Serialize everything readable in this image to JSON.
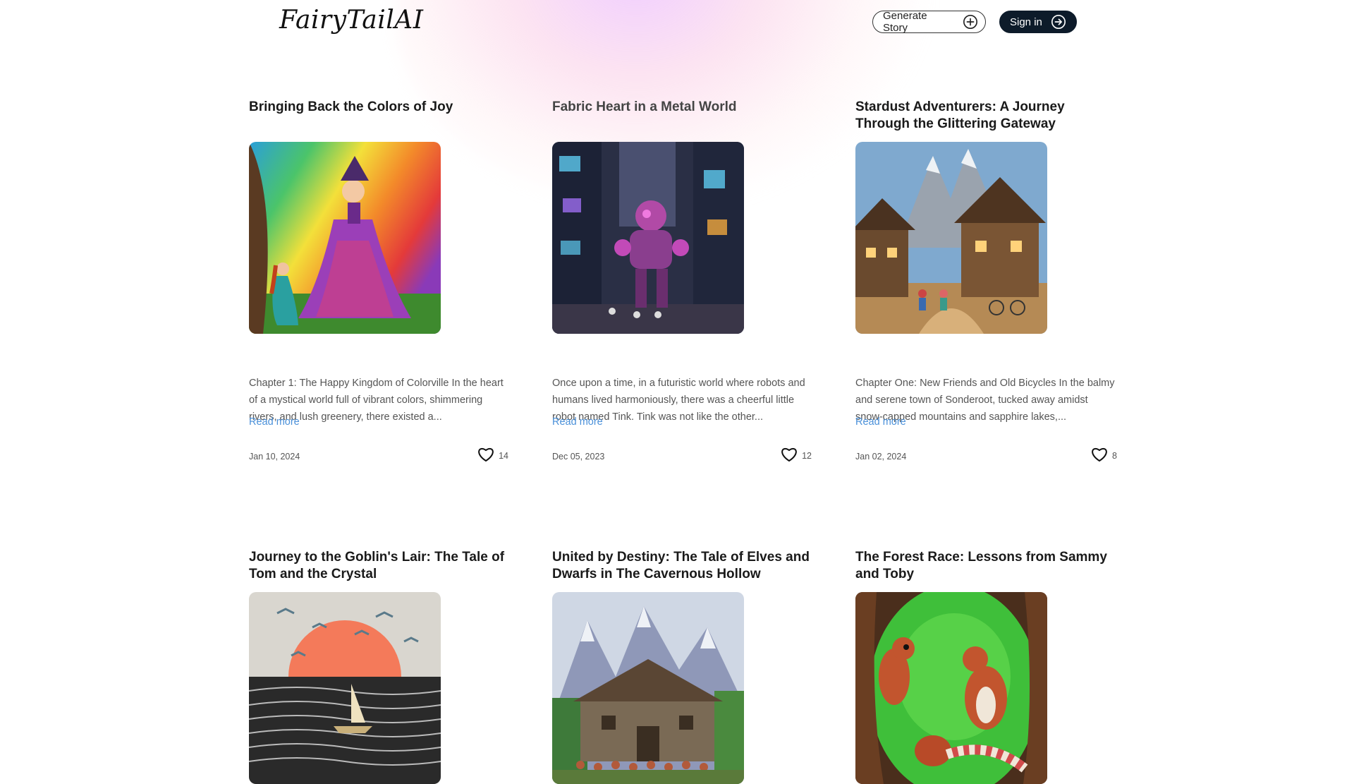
{
  "header": {
    "logo": "FairyTailAI",
    "generate_label": "Generate Story",
    "signin_label": "Sign in"
  },
  "stories": [
    {
      "title": "Bringing Back the Colors of Joy",
      "excerpt": "Chapter 1: The Happy Kingdom of Colorville In the heart of a mystical world full of vibrant colors, shimmering rivers, and lush greenery, there existed a...",
      "read_more": "Read more",
      "date": "Jan 10, 2024",
      "likes": "14"
    },
    {
      "title": "Fabric Heart in a Metal World",
      "excerpt": "Once upon a time, in a futuristic world where robots and humans lived harmoniously, there was a cheerful little robot named Tink. Tink was not like the other...",
      "read_more": "Read more",
      "date": "Dec 05, 2023",
      "likes": "12"
    },
    {
      "title": "Stardust Adventurers: A Journey Through the Glittering Gateway",
      "excerpt": "Chapter One: New Friends and Old Bicycles In the balmy and serene town of Sonderoot, tucked away amidst snow-capped mountains and sapphire lakes,...",
      "read_more": "Read more",
      "date": "Jan 02, 2024",
      "likes": "8"
    },
    {
      "title": "Journey to the Goblin's Lair: The Tale of Tom and the Crystal",
      "excerpt": "",
      "read_more": "",
      "date": "",
      "likes": ""
    },
    {
      "title": "United by Destiny: The Tale of Elves and Dwarfs in The Cavernous Hollow",
      "excerpt": "",
      "read_more": "",
      "date": "",
      "likes": ""
    },
    {
      "title": "The Forest Race: Lessons from Sammy and Toby",
      "excerpt": "",
      "read_more": "",
      "date": "",
      "likes": ""
    }
  ],
  "icons": {
    "generate": "plus-circle-icon",
    "signin": "arrow-right-circle-icon",
    "like": "heart-icon"
  },
  "colors": {
    "dark_button": "#0d1b2a",
    "link": "#4a90d9"
  }
}
